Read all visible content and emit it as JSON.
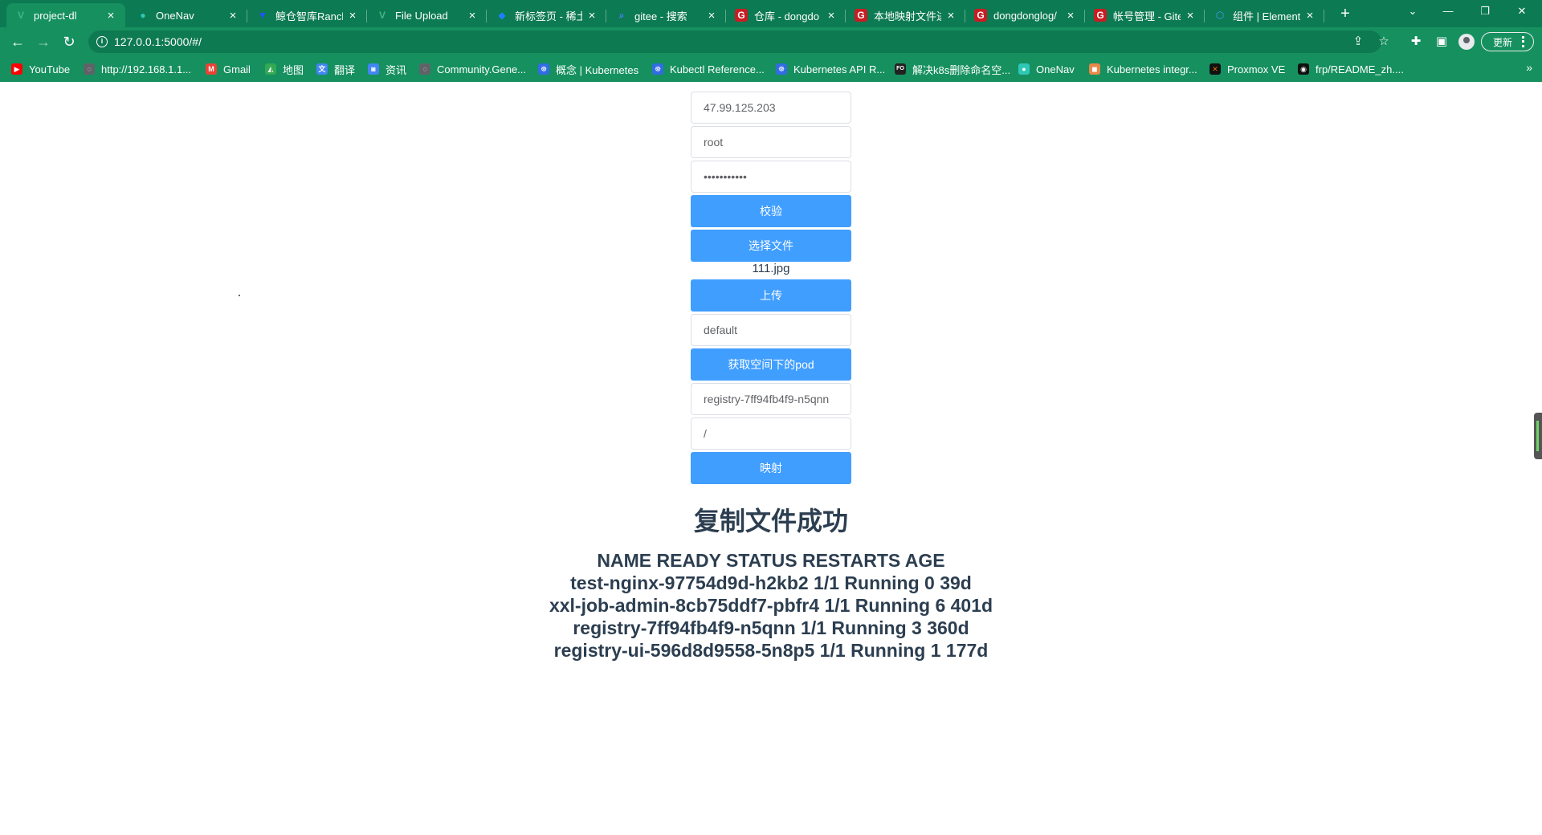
{
  "tabs": [
    {
      "title": "project-dl",
      "icon": "vue-icon",
      "glyph": "V",
      "color": "#41b883",
      "active": true
    },
    {
      "title": "OneNav",
      "icon": "onenav-icon",
      "glyph": "●",
      "color": "#2fc7b5"
    },
    {
      "title": "鲸仓智库Ranch",
      "icon": "rancher-icon",
      "glyph": "▼",
      "color": "#2453ff"
    },
    {
      "title": "File Upload",
      "icon": "vue-icon",
      "glyph": "V",
      "color": "#41b883"
    },
    {
      "title": "新标签页 - 稀土",
      "icon": "juejin-icon",
      "glyph": "◆",
      "color": "#1e80ff"
    },
    {
      "title": "gitee - 搜索",
      "icon": "search-icon",
      "glyph": "⌕",
      "color": "#4285f4"
    },
    {
      "title": "仓库 - dongdo",
      "icon": "gitee-icon",
      "glyph": "G",
      "color": "#c71d23"
    },
    {
      "title": "本地映射文件进",
      "icon": "gitee-icon",
      "glyph": "G",
      "color": "#c71d23"
    },
    {
      "title": "dongdonglog/",
      "icon": "gitee-icon",
      "glyph": "G",
      "color": "#c71d23"
    },
    {
      "title": "帐号管理 - Gite",
      "icon": "gitee-icon",
      "glyph": "G",
      "color": "#c71d23"
    },
    {
      "title": "组件 | Element",
      "icon": "element-icon",
      "glyph": "⬡",
      "color": "#409eff"
    }
  ],
  "address": {
    "url": "127.0.0.1:5000/#/"
  },
  "update_label": "更新",
  "bookmarks": [
    {
      "label": "YouTube",
      "icon": "youtube-icon",
      "color": "#ff0000",
      "glyph": "▶"
    },
    {
      "label": "http://192.168.1.1...",
      "icon": "globe-icon",
      "color": "#5f6368",
      "glyph": "◌"
    },
    {
      "label": "Gmail",
      "icon": "gmail-icon",
      "color": "#ea4335",
      "glyph": "M"
    },
    {
      "label": "地图",
      "icon": "maps-icon",
      "color": "#34a853",
      "glyph": "◭"
    },
    {
      "label": "翻译",
      "icon": "translate-icon",
      "color": "#4285f4",
      "glyph": "文"
    },
    {
      "label": "资讯",
      "icon": "news-icon",
      "color": "#4285f4",
      "glyph": "◙"
    },
    {
      "label": "Community.Gene...",
      "icon": "globe-icon",
      "color": "#5f6368",
      "glyph": "◌"
    },
    {
      "label": "概念 | Kubernetes",
      "icon": "kubernetes-icon",
      "color": "#326ce5",
      "glyph": "☸"
    },
    {
      "label": "Kubectl Reference...",
      "icon": "kubernetes-icon",
      "color": "#326ce5",
      "glyph": "☸"
    },
    {
      "label": "Kubernetes API R...",
      "icon": "kubernetes-icon",
      "color": "#326ce5",
      "glyph": "☸"
    },
    {
      "label": "解决k8s删除命名空...",
      "icon": "csdn-icon",
      "color": "#222222",
      "glyph": "FO"
    },
    {
      "label": "OneNav",
      "icon": "onenav-icon",
      "color": "#2fc7b5",
      "glyph": "●"
    },
    {
      "label": "Kubernetes integr...",
      "icon": "box-icon",
      "color": "#e8884a",
      "glyph": "◼"
    },
    {
      "label": "Proxmox VE",
      "icon": "proxmox-icon",
      "color": "#111111",
      "glyph": "✕"
    },
    {
      "label": "frp/README_zh....",
      "icon": "github-icon",
      "color": "#111111",
      "glyph": "◉"
    }
  ],
  "form": {
    "host_value": "47.99.125.203",
    "user_value": "root",
    "password_value": "•••••••••••",
    "verify_label": "校验",
    "choose_file_label": "选择文件",
    "file_name": "111.jpg",
    "upload_label": "上传",
    "namespace_value": "default",
    "get_pods_label": "获取空间下的pod",
    "pod_value": "registry-7ff94fb4f9-n5qnn",
    "path_value": "/",
    "map_label": "映射"
  },
  "message": "复制文件成功",
  "pods_output": [
    "NAME READY STATUS RESTARTS AGE",
    "test-nginx-97754d9d-h2kb2 1/1 Running 0 39d",
    "xxl-job-admin-8cb75ddf7-pbfr4 1/1 Running 6 401d",
    "registry-7ff94fb4f9-n5qnn 1/1 Running 3 360d",
    "registry-ui-596d8d9558-5n8p5 1/1 Running 1 177d"
  ],
  "colors": {
    "chrome": "#16905f",
    "tabbar": "#0c7a52",
    "primary_button": "#409eff",
    "text": "#2c3e50"
  }
}
